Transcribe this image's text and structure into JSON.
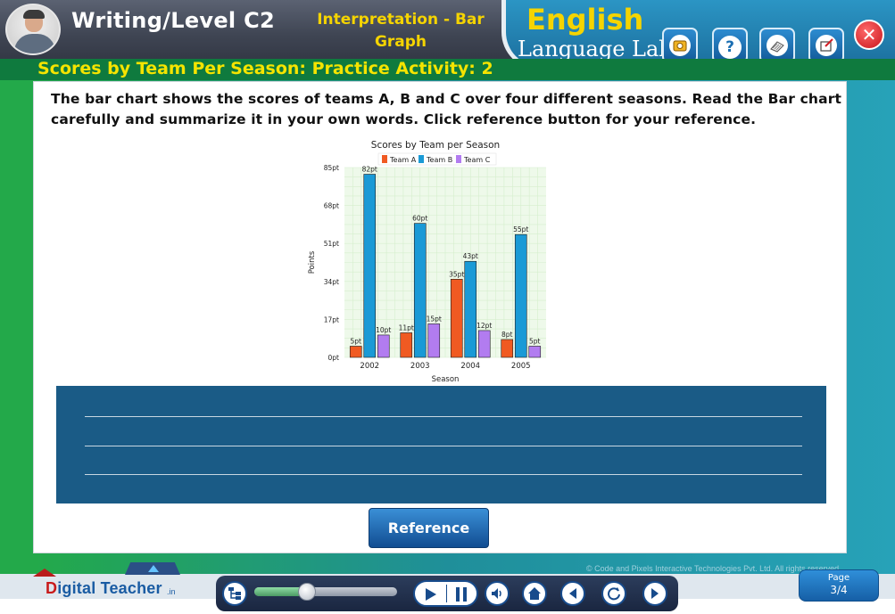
{
  "header": {
    "level_title": "Writing/Level C2",
    "sub_title": "Interpretation - Bar Graph",
    "lab_title": "English",
    "lab_subtitle": "Language Lab",
    "buttons": [
      {
        "icon": "photo-icon"
      },
      {
        "icon": "help-icon",
        "glyph": "?"
      },
      {
        "icon": "notes-icon"
      },
      {
        "icon": "edit-icon"
      }
    ],
    "close_glyph": "✕"
  },
  "activity": {
    "title": "Scores by Team Per Season: Practice Activity: 2",
    "instruction": "The bar chart shows the scores of teams A, B and C over four different seasons. Read the Bar chart carefully and summarize it in your own words. Click reference button for your reference."
  },
  "chart_data": {
    "type": "bar",
    "title": "Scores by Team per Season",
    "xlabel": "Season",
    "ylabel": "Points",
    "categories": [
      "2002",
      "2003",
      "2004",
      "2005"
    ],
    "series": [
      {
        "name": "Team A",
        "color": "#f05a22",
        "values": [
          5,
          11,
          35,
          8
        ],
        "labels": [
          "5pt",
          "11pt",
          "35pt",
          "8pt"
        ]
      },
      {
        "name": "Team B",
        "color": "#1a9ad6",
        "values": [
          82,
          60,
          43,
          55
        ],
        "labels": [
          "82pt",
          "60pt",
          "43pt",
          "55pt"
        ]
      },
      {
        "name": "Team C",
        "color": "#b27cf0",
        "values": [
          10,
          15,
          12,
          5
        ],
        "labels": [
          "10pt",
          "15pt",
          "12pt",
          "5pt"
        ]
      }
    ],
    "yticks": [
      0,
      17,
      34,
      51,
      68,
      85
    ],
    "ytick_labels": [
      "0pt",
      "17pt",
      "34pt",
      "51pt",
      "68pt",
      "85pt"
    ],
    "ylim": [
      0,
      85
    ],
    "legend": "top",
    "grid": true,
    "plot_background": "#eef9ea"
  },
  "answer": {
    "lines": 3
  },
  "reference_label": "Reference",
  "footer": {
    "brand_prefix": "D",
    "brand_rest": "igital Teacher",
    "brand_suffix": ".in",
    "copyright": "© Code and Pixels Interactive Technologies Pvt. Ltd. All rights reserved.",
    "page_label": "Page",
    "page_number": "3/4",
    "progress": 0.37
  },
  "colors": {
    "accent_yellow": "#f5d400",
    "header_blue": "#1c6f9e",
    "answer_box": "#1a5b86"
  }
}
